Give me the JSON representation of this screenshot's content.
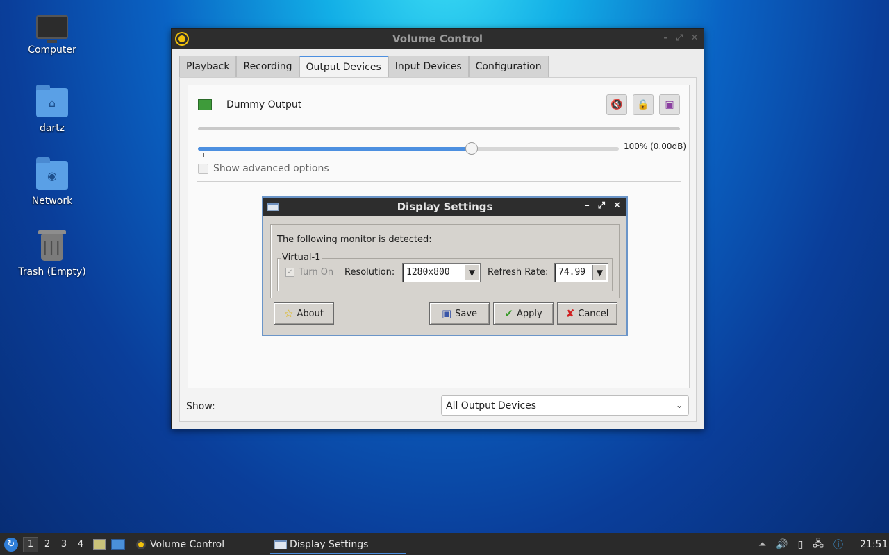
{
  "desktop": {
    "icons": [
      {
        "label": "Computer",
        "icon": "computer-icon"
      },
      {
        "label": "dartz",
        "icon": "home-folder-icon"
      },
      {
        "label": "Network",
        "icon": "network-folder-icon"
      },
      {
        "label": "Trash (Empty)",
        "icon": "trash-icon"
      }
    ]
  },
  "volume_window": {
    "title": "Volume Control",
    "tabs": [
      "Playback",
      "Recording",
      "Output Devices",
      "Input Devices",
      "Configuration"
    ],
    "active_tab": "Output Devices",
    "device_name": "Dummy Output",
    "volume_label": "100% (0.00dB)",
    "volume_fraction": 1.0,
    "advanced_label": "Show advanced options",
    "show_label": "Show:",
    "show_value": "All Output Devices"
  },
  "display_dialog": {
    "title": "Display Settings",
    "detected_text": "The following monitor is detected:",
    "monitor_name": "Virtual-1",
    "turn_on_label": "Turn On",
    "resolution_label": "Resolution:",
    "resolution_value": "1280x800",
    "refresh_label": "Refresh Rate:",
    "refresh_value": "74.99",
    "buttons": {
      "about": "About",
      "save": "Save",
      "apply": "Apply",
      "cancel": "Cancel"
    }
  },
  "taskbar": {
    "workspaces": [
      "1",
      "2",
      "3",
      "4"
    ],
    "active_workspace": "1",
    "tasks": [
      "Volume Control",
      "Display Settings"
    ],
    "clock": "21:51"
  },
  "colors": {
    "accent": "#4c8fe0",
    "titlebar": "#2d2d2d",
    "taskbar": "#2a2a2a"
  }
}
